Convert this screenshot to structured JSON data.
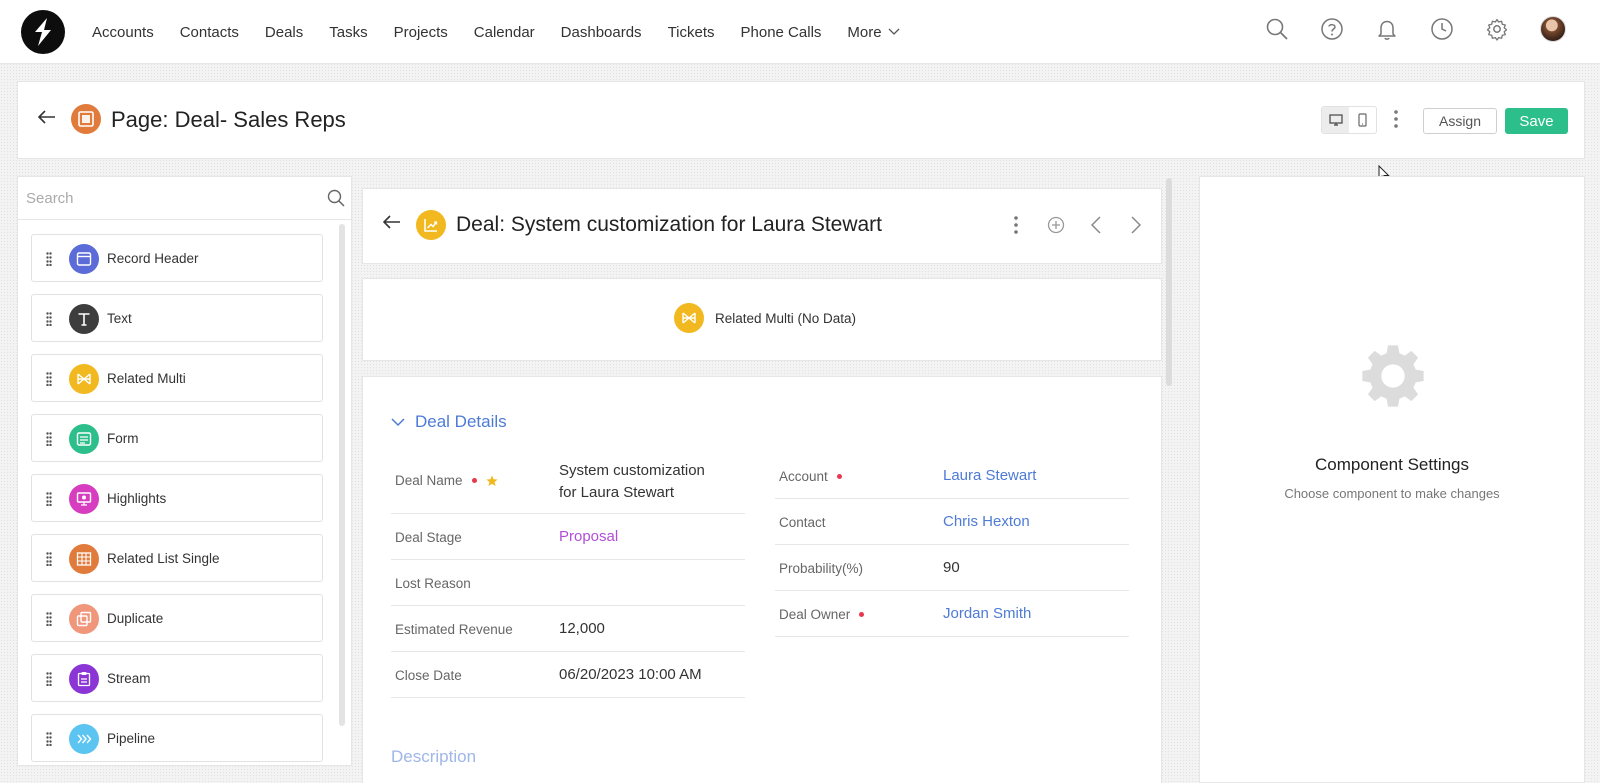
{
  "nav": {
    "items": [
      "Accounts",
      "Contacts",
      "Deals",
      "Tasks",
      "Projects",
      "Calendar",
      "Dashboards",
      "Tickets",
      "Phone Calls"
    ],
    "more_label": "More"
  },
  "page": {
    "title": "Page: Deal- Sales Reps",
    "assign_label": "Assign",
    "save_label": "Save"
  },
  "left_panel": {
    "search_placeholder": "Search",
    "components": [
      {
        "label": "Record Header",
        "icon": "record-header-icon",
        "color": "#5b6bd8"
      },
      {
        "label": "Text",
        "icon": "text-icon",
        "color": "#3d3d3d"
      },
      {
        "label": "Related Multi",
        "icon": "related-multi-icon",
        "color": "#f2b81f"
      },
      {
        "label": "Form",
        "icon": "form-icon",
        "color": "#2dbf8b"
      },
      {
        "label": "Highlights",
        "icon": "highlights-icon",
        "color": "#d63dbf"
      },
      {
        "label": "Related List Single",
        "icon": "related-list-single-icon",
        "color": "#e07b3c"
      },
      {
        "label": "Duplicate",
        "icon": "duplicate-icon",
        "color": "#f0967a"
      },
      {
        "label": "Stream",
        "icon": "stream-icon",
        "color": "#8b35d6"
      },
      {
        "label": "Pipeline",
        "icon": "pipeline-icon",
        "color": "#5bc4f0"
      }
    ]
  },
  "record": {
    "title": "Deal: System customization for Laura Stewart",
    "related_multi_label": "Related Multi (No Data)"
  },
  "details": {
    "section_title": "Deal Details",
    "second_section_title": "Description",
    "left_fields": [
      {
        "label": "Deal Name",
        "value_line1": "System customization",
        "value_line2": "for Laura Stewart"
      },
      {
        "label": "Deal Stage",
        "value": "Proposal"
      },
      {
        "label": "Lost Reason",
        "value": ""
      },
      {
        "label": "Estimated Revenue",
        "value": "12,000"
      },
      {
        "label": "Close Date",
        "value": "06/20/2023 10:00 AM"
      }
    ],
    "right_fields": [
      {
        "label": "Account",
        "value": "Laura Stewart"
      },
      {
        "label": "Contact",
        "value": "Chris Hexton"
      },
      {
        "label": "Probability(%)",
        "value": "90"
      },
      {
        "label": "Deal Owner",
        "value": "Jordan Smith"
      }
    ]
  },
  "settings": {
    "title": "Component Settings",
    "subtitle": "Choose component to make changes"
  },
  "colors": {
    "accent_green": "#2dbf8b",
    "link_blue": "#4d7bd6",
    "stage_purple": "#b24ed8",
    "required_red": "#e8384f",
    "star_yellow": "#f2b81f"
  }
}
